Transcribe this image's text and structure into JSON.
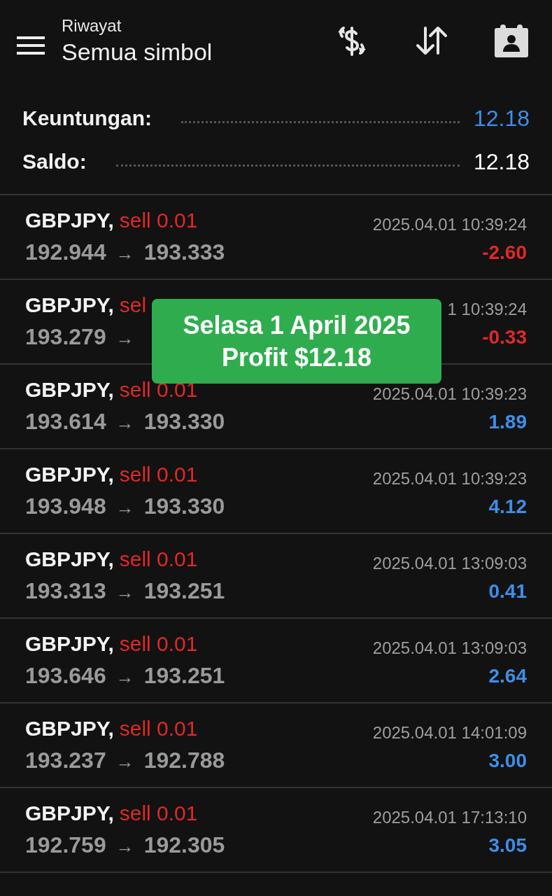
{
  "header": {
    "subtitle": "Riwayat",
    "title": "Semua simbol"
  },
  "summary": [
    {
      "label": "Keuntungan:",
      "value": "12.18",
      "highlight": true
    },
    {
      "label": "Saldo:",
      "value": "12.18",
      "highlight": false
    }
  ],
  "trades": [
    {
      "symbol": "GBPJPY,",
      "side": "sell 0.01",
      "open_price": "192.944",
      "arrow": "→",
      "close_price": "193.333",
      "time": "2025.04.01 10:39:24",
      "profit": "-2.60",
      "loss": true
    },
    {
      "symbol": "GBPJPY,",
      "side": "sel",
      "open_price": "193.279",
      "arrow": "→",
      "time": "1 10:39:24",
      "profit": "-0.33",
      "loss": true
    },
    {
      "symbol": "GBPJPY,",
      "side": "sell 0.01",
      "open_price": "193.614",
      "arrow": "→",
      "close_price": "193.330",
      "time": "2025.04.01 10:39:23",
      "profit": "1.89",
      "loss": false
    },
    {
      "symbol": "GBPJPY,",
      "side": "sell 0.01",
      "open_price": "193.948",
      "arrow": "→",
      "close_price": "193.330",
      "time": "2025.04.01 10:39:23",
      "profit": "4.12",
      "loss": false
    },
    {
      "symbol": "GBPJPY,",
      "side": "sell 0.01",
      "open_price": "193.313",
      "arrow": "→",
      "close_price": "193.251",
      "time": "2025.04.01 13:09:03",
      "profit": "0.41",
      "loss": false
    },
    {
      "symbol": "GBPJPY,",
      "side": "sell 0.01",
      "open_price": "193.646",
      "arrow": "→",
      "close_price": "193.251",
      "time": "2025.04.01 13:09:03",
      "profit": "2.64",
      "loss": false
    },
    {
      "symbol": "GBPJPY,",
      "side": "sell 0.01",
      "open_price": "193.237",
      "arrow": "→",
      "close_price": "192.788",
      "time": "2025.04.01 14:01:09",
      "profit": "3.00",
      "loss": false
    },
    {
      "symbol": "GBPJPY,",
      "side": "sell 0.01",
      "open_price": "192.759",
      "arrow": "→",
      "close_price": "192.305",
      "time": "2025.04.01 17:13:10",
      "profit": "3.05",
      "loss": false
    }
  ],
  "toast": {
    "lines": [
      "Selasa 1 April 2025",
      "Profit $12.18"
    ]
  }
}
